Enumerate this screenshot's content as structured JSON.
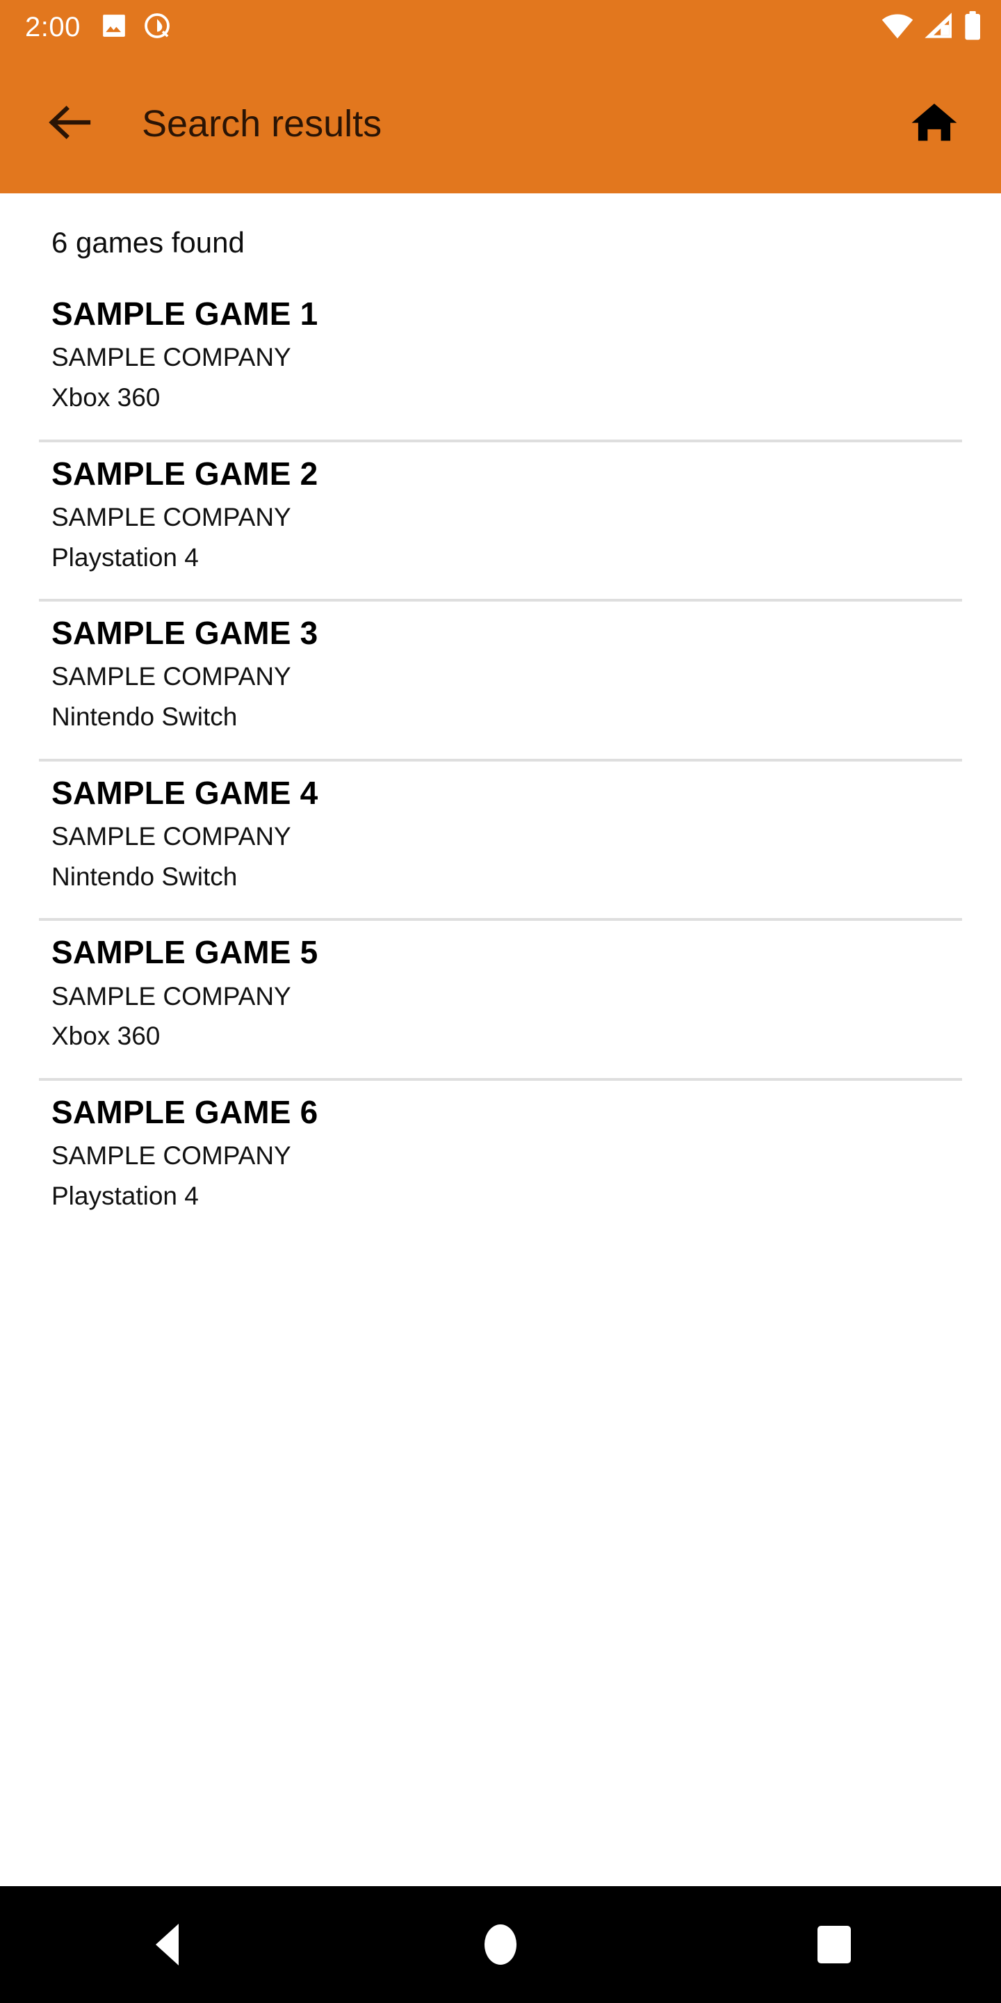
{
  "theme": {
    "accent": "#E2771E",
    "appbar_text": "#2A1405",
    "divider": "#DEDEDE",
    "navbar_bg": "#000000",
    "content_bg": "#FFFFFF"
  },
  "status_bar": {
    "clock": "2:00",
    "left_icons": [
      "image-icon",
      "dnd-icon"
    ],
    "right_icons": [
      "wifi-icon",
      "cellular-signal-icon",
      "battery-icon"
    ]
  },
  "app_bar": {
    "back_icon": "arrow-left-icon",
    "title": "Search results",
    "home_icon": "home-icon"
  },
  "content": {
    "results_count": "6 games found",
    "results": [
      {
        "title": "SAMPLE GAME 1",
        "company": "SAMPLE COMPANY",
        "platform": "Xbox 360"
      },
      {
        "title": "SAMPLE GAME 2",
        "company": "SAMPLE COMPANY",
        "platform": "Playstation 4"
      },
      {
        "title": "SAMPLE GAME 3",
        "company": "SAMPLE COMPANY",
        "platform": "Nintendo Switch"
      },
      {
        "title": "SAMPLE GAME 4",
        "company": "SAMPLE COMPANY",
        "platform": "Nintendo Switch"
      },
      {
        "title": "SAMPLE GAME 5",
        "company": "SAMPLE COMPANY",
        "platform": "Xbox 360"
      },
      {
        "title": "SAMPLE GAME 6",
        "company": "SAMPLE COMPANY",
        "platform": "Playstation 4"
      }
    ]
  },
  "nav_bar": {
    "back_label": "Back",
    "home_label": "Home",
    "recents_label": "Recents"
  }
}
